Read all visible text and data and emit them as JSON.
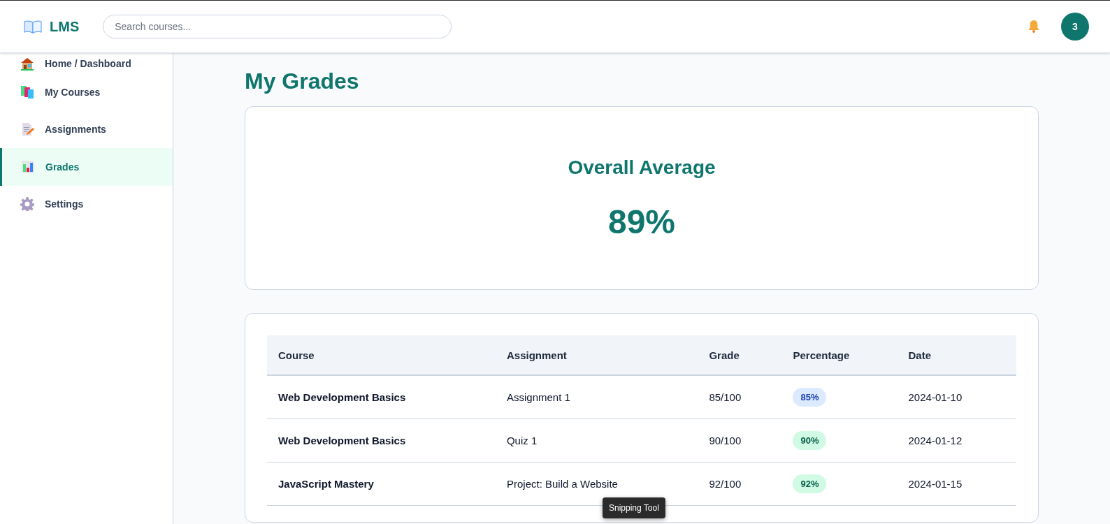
{
  "header": {
    "logo": "LMS",
    "search": {
      "placeholder": "Search courses..."
    },
    "avatar": "3"
  },
  "sidebar": {
    "items": [
      {
        "kind": "house",
        "label": "Home / Dashboard",
        "selected": false
      },
      {
        "kind": "books",
        "label": "My Courses",
        "selected": false
      },
      {
        "kind": "document",
        "label": "Assignments",
        "selected": false
      },
      {
        "kind": "chart",
        "label": "Grades",
        "selected": true
      },
      {
        "kind": "gear",
        "label": "Settings",
        "selected": false
      }
    ]
  },
  "page": {
    "title": "My Grades"
  },
  "summary": {
    "label": "Overall Average",
    "value": "89%"
  },
  "table": {
    "columns": [
      "Course",
      "Assignment",
      "Grade",
      "Percentage",
      "Date"
    ],
    "rows": [
      {
        "course": "Web Development Basics",
        "assignment": "Assignment 1",
        "grade": "85/100",
        "percentage": {
          "text": "85%",
          "color": "#dbeafe"
        },
        "date": "2024-01-10"
      },
      {
        "course": "Web Development Basics",
        "assignment": "Quiz 1",
        "grade": "90/100",
        "percentage": {
          "text": "90%",
          "color": "#d1fae5"
        },
        "date": "2024-01-12"
      },
      {
        "course": "JavaScript Mastery",
        "assignment": "Project: Build a Website",
        "grade": "92/100",
        "percentage": {
          "text": "92%",
          "color": "#d1fae5"
        },
        "date": "2024-01-15"
      }
    ]
  },
  "tooltip": "Snipping Tool"
}
